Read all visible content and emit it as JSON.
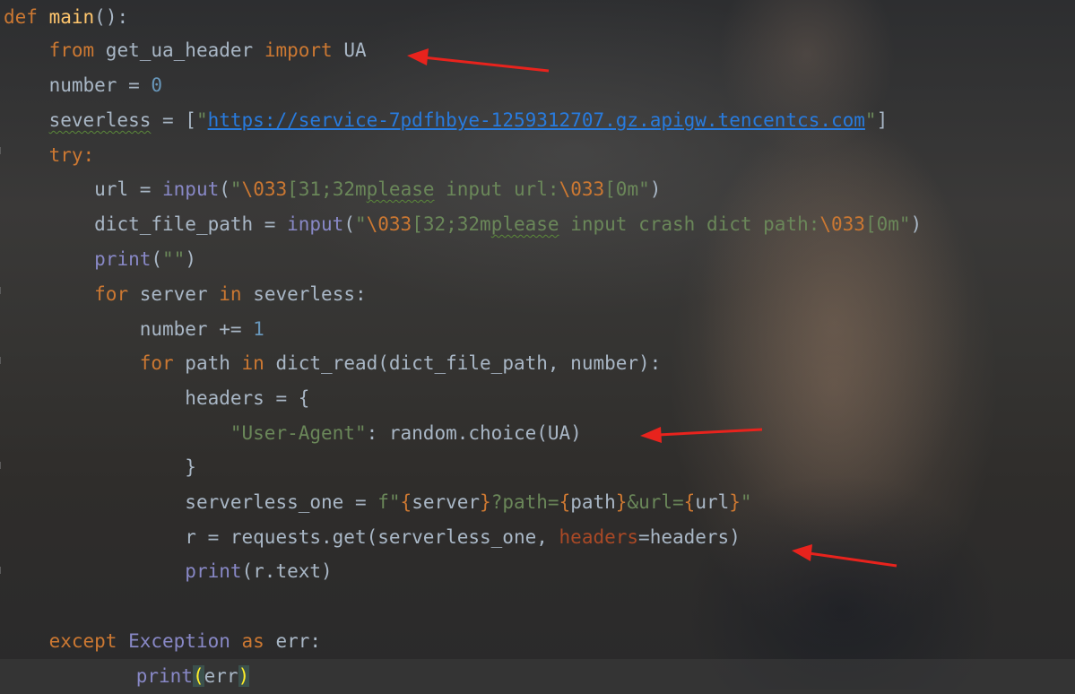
{
  "code": {
    "line1": {
      "def": "def",
      "name": "main",
      "rest": "():"
    },
    "line2": {
      "from": "from",
      "module": " get_ua_header ",
      "import": "import",
      "name": " UA"
    },
    "line3": {
      "var": "number = ",
      "num": "0"
    },
    "line4": {
      "var": "severless",
      "eq": " = [",
      "q1": "\"",
      "url": "https://service-7pdfhbye-1259312707.gz.apigw.tencentcs.com",
      "q2": "\"",
      "close": "]"
    },
    "line5": {
      "try": "try",
      "colon": ":"
    },
    "line6": {
      "var": "url = ",
      "fn": "input",
      "open": "(",
      "s1": "\"",
      "esc1": "\\033",
      "s2": "[31;32m",
      "w1": "please",
      "s3": " input url:",
      "esc2": "\\033",
      "s4": "[0m\"",
      "close": ")"
    },
    "line7": {
      "var": "dict_file_path = ",
      "fn": "input",
      "open": "(",
      "s1": "\"",
      "esc1": "\\033",
      "s2": "[32;32m",
      "w1": "please",
      "s3": " input crash dict path:",
      "esc2": "\\033",
      "s4": "[0m\"",
      "close": ")"
    },
    "line8": {
      "fn": "print",
      "open": "(",
      "s": "\"\"",
      "close": ")"
    },
    "line9": {
      "for": "for",
      "a": " server ",
      "in": "in",
      "b": " severless:"
    },
    "line10": {
      "var": "number += ",
      "num": "1"
    },
    "line11": {
      "for": "for",
      "a": " path ",
      "in": "in",
      "b": " dict_read(dict_file_path, number):"
    },
    "line12": {
      "text": "headers = {"
    },
    "line13": {
      "s": "\"User-Agent\"",
      "rest": ": random.choice(UA)"
    },
    "line14": {
      "text": "}"
    },
    "line15": {
      "var": "serverless_one = ",
      "f": "f\"",
      "o1": "{",
      "v1": "server",
      "c1": "}",
      "t1": "?path=",
      "o2": "{",
      "v2": "path",
      "c2": "}",
      "t2": "&url=",
      "o3": "{",
      "v3": "url",
      "c3": "}",
      "end": "\""
    },
    "line16": {
      "a": "r = requests.get(serverless_one, ",
      "param": "headers",
      "b": "=headers)"
    },
    "line17": {
      "fn": "print",
      "rest": "(r.text)"
    },
    "line19": {
      "except": "except",
      "exc": " Exception ",
      "as": "as",
      "rest": " err:"
    },
    "line20": {
      "fn": "print",
      "open": "(",
      "mid": "err",
      "close": ")"
    }
  },
  "colors": {
    "arrow": "#e8231d",
    "keyword": "#cc7832",
    "string": "#6a8759",
    "number": "#6897bb",
    "builtin": "#8888c6"
  }
}
